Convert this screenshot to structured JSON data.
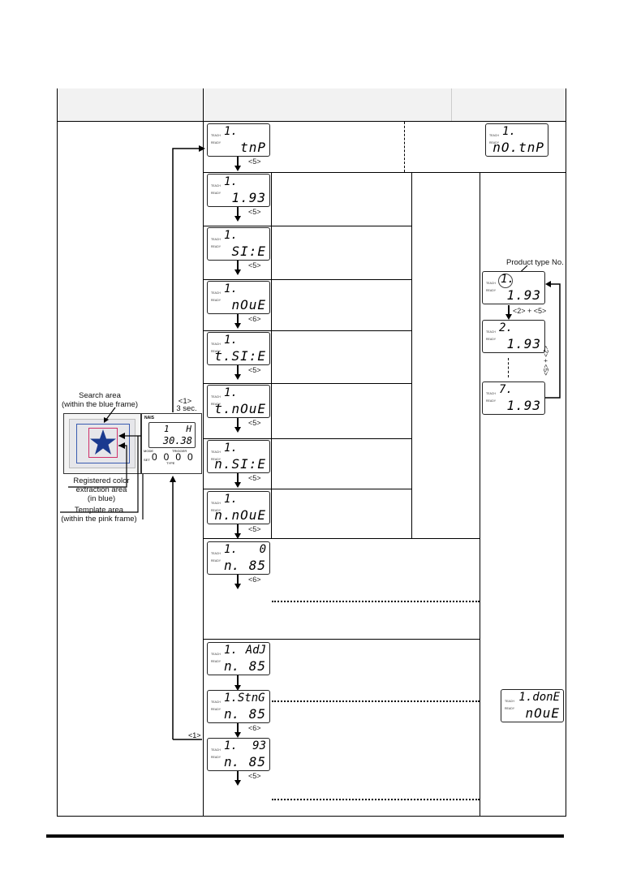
{
  "table": {
    "header_cells": [
      "",
      "",
      ""
    ]
  },
  "lcd_labels": {
    "teach": "TEACH",
    "ready": "READY"
  },
  "main_flow": [
    {
      "id": "tmp",
      "top": "1.",
      "bottom": "tnP",
      "key": "<5>"
    },
    {
      "id": "value",
      "top": "1.",
      "bottom": "1.93",
      "key": "<5>"
    },
    {
      "id": "size",
      "top": "1.",
      "bottom": "SI:E",
      "key": "<5>"
    },
    {
      "id": "move",
      "top": "1.",
      "bottom": "nOuE",
      "key": "<6>"
    },
    {
      "id": "tsize",
      "top": "1.",
      "bottom": "t.SI:E",
      "key": "<5>"
    },
    {
      "id": "tmove",
      "top": "1.",
      "bottom": "t.nOuE",
      "key": "<5>"
    },
    {
      "id": "nsize",
      "top": "1.",
      "bottom": "n.SI:E",
      "key": "<5>"
    },
    {
      "id": "nmove",
      "top": "1.",
      "bottom": "n.nOuE",
      "key": "<5>"
    },
    {
      "id": "n85",
      "top": "1.",
      "top_right": "0",
      "bottom_left": "n.",
      "bottom": "85",
      "key": "<6>"
    },
    {
      "id": "adj",
      "top": "1.",
      "top_right": "AdJ",
      "bottom_left": "n.",
      "bottom": "85",
      "key": ""
    },
    {
      "id": "stng",
      "top": "1.StnG",
      "bottom_left": "n.",
      "bottom": "85",
      "key": "<6>"
    },
    {
      "id": "result",
      "top": "1.",
      "top_right": "93",
      "bottom_left": "n.",
      "bottom": "85",
      "key": "<5>"
    }
  ],
  "no_tmp_display": {
    "top": "1.",
    "bottom": "nO.tnP"
  },
  "done_display": {
    "top": "1.donE",
    "bottom": "nOuE"
  },
  "product_type": {
    "label": "Product type No.",
    "displays": [
      {
        "top": "1.",
        "bottom": "1.93"
      },
      {
        "top": "2.",
        "bottom": "1.93"
      },
      {
        "top": "7.",
        "bottom": "1.93"
      }
    ],
    "key_forward": "<2> + <5>",
    "key_side": "<2> + <5>"
  },
  "camera": {
    "search_area": "Search area\n(within the blue frame)",
    "color_area": "Registered color\nextraction area\n(in blue)",
    "template_area": "Template area\n(within the pink frame)",
    "key_hold": "<1>",
    "key_hold_time": "3 sec.",
    "key_return": "<1>",
    "brand": "NAIS",
    "lcd_top_left": "1",
    "lcd_top_right": "H",
    "lcd_bottom": "30.38",
    "mode_label": "MODE",
    "trigger_label": "TRIGGER",
    "set_label": "SET",
    "type_label": "TYPE"
  },
  "colors": {
    "blue_frame": "#3a5bb0",
    "pink_frame": "#d0306a",
    "star": "#1a3a8f",
    "panel_bg": "#e6e6ea"
  }
}
